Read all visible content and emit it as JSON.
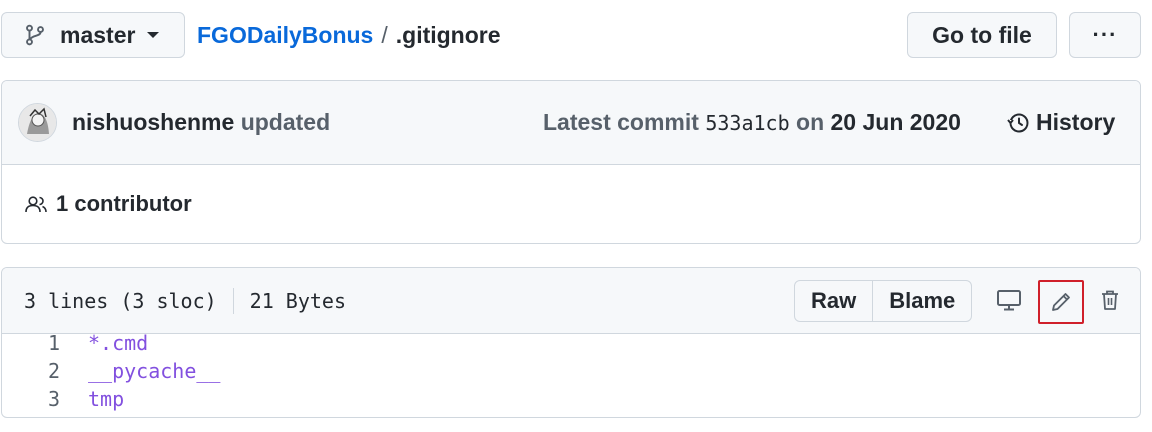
{
  "branch": {
    "name": "master",
    "icon": "git-branch-icon"
  },
  "breadcrumb": {
    "repo": "FGODailyBonus",
    "separator": "/",
    "file": ".gitignore"
  },
  "header_actions": {
    "go_to_file": "Go to file",
    "more": "···"
  },
  "commit": {
    "author": "nishuoshenme",
    "message": "updated",
    "latest_prefix": "Latest commit",
    "sha": "533a1cb",
    "on": "on",
    "date": "20 Jun 2020",
    "history": "History"
  },
  "contributors": {
    "label": "1 contributor"
  },
  "file": {
    "lines_info": "3 lines (3 sloc)",
    "size": "21 Bytes",
    "raw": "Raw",
    "blame": "Blame",
    "lines": [
      {
        "num": "1",
        "text": "*.cmd"
      },
      {
        "num": "2",
        "text": "__pycache__"
      },
      {
        "num": "3",
        "text": "tmp"
      }
    ]
  },
  "colors": {
    "link": "#0969da",
    "code_text": "#8250df",
    "highlight_border": "#d0202a"
  }
}
